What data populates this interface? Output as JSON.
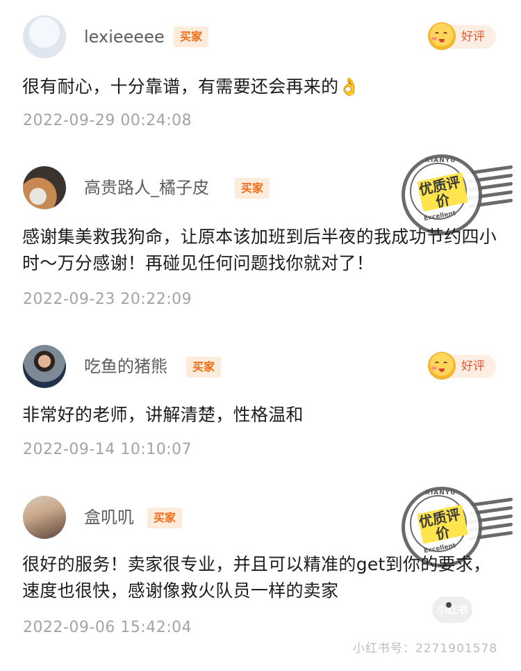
{
  "colors": {
    "badge_bg": "#fdebdc",
    "badge_text": "#f06a14",
    "good_tag_text": "#e9592f",
    "timestamp": "#a3a3a3",
    "username": "#5c5c5c"
  },
  "reviews": [
    {
      "username": "lexieeeee",
      "badge": "买家",
      "rating_label": "好评",
      "content": "很有耐心，十分靠谱，有需要还会再来的👌",
      "timestamp": "2022-09-29 00:24:08"
    },
    {
      "username": "高贵路人_橘子皮",
      "badge": "买家",
      "content": "感谢集美救我狗命，让原本该加班到后半夜的我成功节约四小时～万分感谢！再碰见任何问题找你就对了！",
      "timestamp": "2022-09-23 20:22:09",
      "stamp": {
        "top": "XIANYU",
        "main": "优质评价",
        "bottom": "Excellent"
      }
    },
    {
      "username": "吃鱼的猪熊",
      "badge": "买家",
      "rating_label": "好评",
      "content": "非常好的老师，讲解清楚，性格温和",
      "timestamp": "2022-09-14 10:10:07"
    },
    {
      "username": "盒叽叽",
      "badge": "买家",
      "content": "很好的服务！卖家很专业，并且可以精准的get到你的要求，速度也很快，感谢像救火队员一样的卖家",
      "timestamp": "2022-09-06 15:42:04",
      "stamp": {
        "top": "XIANYU",
        "main": "优质评价",
        "bottom": "Excellent"
      }
    }
  ],
  "watermark": {
    "bubble_text": "小红书",
    "id_text": "小红书号：2271901578"
  }
}
